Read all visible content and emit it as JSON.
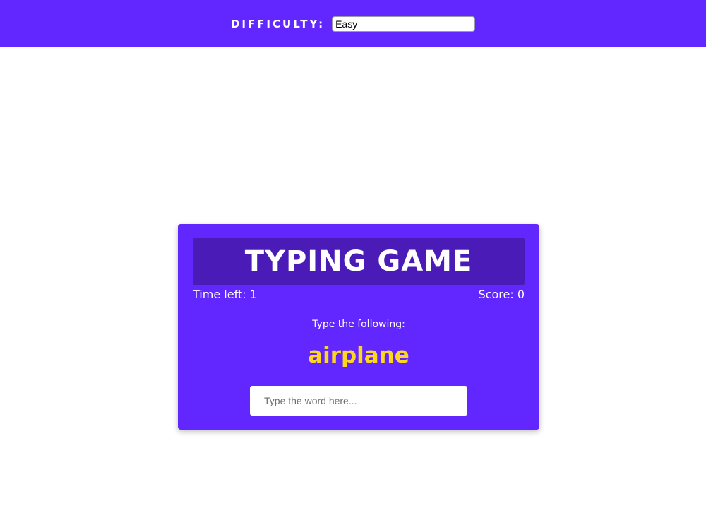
{
  "header": {
    "difficulty_label": "DIFFICULTY:",
    "difficulty_selected": "Easy"
  },
  "game": {
    "title": "TYPING GAME",
    "time_left": "Time left: 1",
    "score": "Score: 0",
    "prompt": "Type the following:",
    "word": "airplane",
    "input_placeholder": "Type the word here..."
  },
  "colors": {
    "brand_purple": "#6127fe",
    "title_box": "#4a1bb7",
    "word_yellow": "#fdd71f"
  }
}
